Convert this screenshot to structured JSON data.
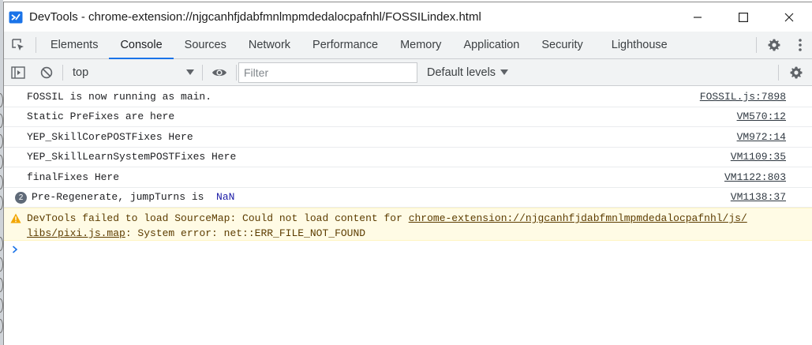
{
  "window": {
    "title": "DevTools - chrome-extension://njgcanhfjdabfmnlmpmdedalocpafnhl/FOSSILindex.html"
  },
  "tabs": [
    {
      "label": "Elements"
    },
    {
      "label": "Console"
    },
    {
      "label": "Sources"
    },
    {
      "label": "Network"
    },
    {
      "label": "Performance"
    },
    {
      "label": "Memory"
    },
    {
      "label": "Application"
    },
    {
      "label": "Security"
    },
    {
      "label": "Lighthouse"
    }
  ],
  "toolbar": {
    "context": "top",
    "filter_placeholder": "Filter",
    "levels": "Default levels"
  },
  "messages": [
    {
      "text": "FOSSIL is now running as main.",
      "source": "FOSSIL.js:7898"
    },
    {
      "text": "Static PreFixes are here",
      "source": "VM570:12"
    },
    {
      "text": "YEP_SkillCorePOSTFixes Here",
      "source": "VM972:14"
    },
    {
      "text": "YEP_SkillLearnSystemPOSTFixes Here",
      "source": "VM1109:35"
    },
    {
      "text": "finalFixes Here",
      "source": "VM1122:803"
    },
    {
      "count": "2",
      "text": "Pre-Regenerate, jumpTurns is  ",
      "value": "NaN",
      "source": "VM1138:37"
    }
  ],
  "warning": {
    "prefix": "DevTools failed to load SourceMap: Could not load content for ",
    "link_line1": "chrome-extension://njgcanhfjdabfmnlmpmdedalocpafnhl/js/",
    "link_line2": "libs/pixi.js.map",
    "suffix": ": System error: net::ERR_FILE_NOT_FOUND"
  },
  "colors": {
    "accent": "#1a73e8",
    "warning_bg": "#fffbe5",
    "warning_text": "#5c3c00",
    "nan_value": "#1a1aa6"
  }
}
